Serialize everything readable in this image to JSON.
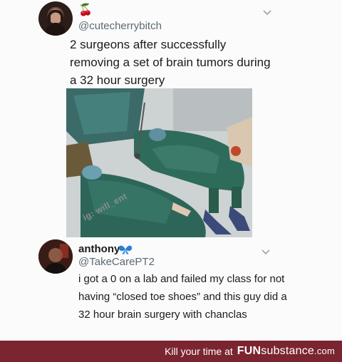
{
  "tweet": {
    "emoji": "🍒",
    "handle": "@cutecherrybitch",
    "text": "2 surgeons after successfully removing a set of brain tumors during a 32 hour surgery"
  },
  "photo": {
    "watermark": "ig: will_ent"
  },
  "reply": {
    "name": "anthony",
    "handle": "@TakeCarePT2",
    "text": "i got a 0 on a lab and failed my class for not having “closed toe shoes” and this guy did a 32 hour brain surgery with chanclas",
    "heart_color": "#2a7fd4"
  },
  "footer": {
    "text": "Kill your time at",
    "brand_bold": "FUN",
    "brand_thin": "substance",
    "domain": ".com",
    "bg": "#7a2530"
  }
}
